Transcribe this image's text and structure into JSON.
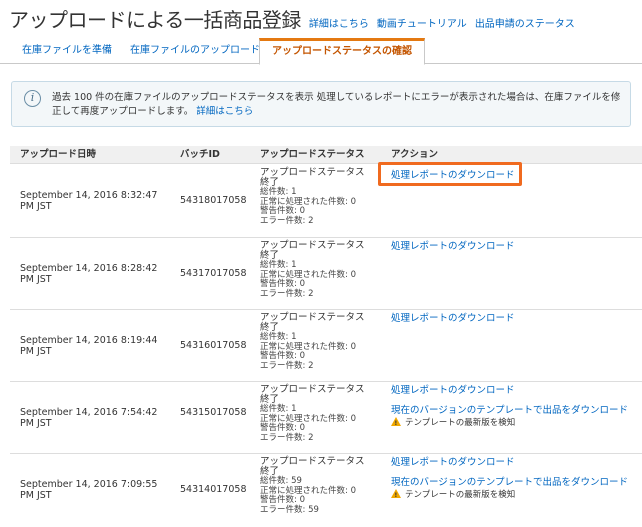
{
  "header": {
    "title": "アップロードによる一括商品登録",
    "links": [
      "詳細はこちら",
      "動画チュートリアル",
      "出品申請のステータス"
    ]
  },
  "tabs": [
    {
      "label": "在庫ファイルを準備"
    },
    {
      "label": "在庫ファイルのアップロード"
    },
    {
      "label": "アップロードステータスの確認",
      "active": true
    }
  ],
  "info": {
    "text": "過去 100 件の在庫ファイルのアップロードステータスを表示 処理しているレポートにエラーが表示された場合は、在庫ファイルを修正して再度アップロードします。",
    "link": "詳細はこちら"
  },
  "table": {
    "headers": [
      "アップロード日時",
      "バッチID",
      "アップロードステータス",
      "アクション"
    ],
    "rows": [
      {
        "date": "September 14, 2016 8:32:47 PM JST",
        "batch": "54318017058",
        "status": "アップロードステータス",
        "state": "終了",
        "total": "総件数: 1",
        "ok": "正常に処理された件数: 0",
        "warnings": "警告件数: 0",
        "errors": "エラー件数: 2",
        "action": "処理レポートのダウンロード"
      },
      {
        "date": "September 14, 2016 8:28:42 PM JST",
        "batch": "54317017058",
        "status": "アップロードステータス",
        "state": "終了",
        "total": "総件数: 1",
        "ok": "正常に処理された件数: 0",
        "warnings": "警告件数: 0",
        "errors": "エラー件数: 2",
        "action": "処理レポートのダウンロード"
      },
      {
        "date": "September 14, 2016 8:19:44 PM JST",
        "batch": "54316017058",
        "status": "アップロードステータス",
        "state": "終了",
        "total": "総件数: 1",
        "ok": "正常に処理された件数: 0",
        "warnings": "警告件数: 0",
        "errors": "エラー件数: 2",
        "action": "処理レポートのダウンロード"
      },
      {
        "date": "September 14, 2016 7:54:42 PM JST",
        "batch": "54315017058",
        "status": "アップロードステータス",
        "state": "終了",
        "total": "総件数: 1",
        "ok": "正常に処理された件数: 0",
        "warnings": "警告件数: 0",
        "errors": "エラー件数: 2",
        "action": "処理レポートのダウンロード",
        "action2": "現在のバージョンのテンプレートで出品をダウンロード",
        "warn": "テンプレートの最新版を検知"
      },
      {
        "date": "September 14, 2016 7:09:55 PM JST",
        "batch": "54314017058",
        "status": "アップロードステータス",
        "state": "終了",
        "total": "総件数: 59",
        "ok": "正常に処理された件数: 0",
        "warnings": "警告件数: 0",
        "errors": "エラー件数: 59",
        "action": "処理レポートのダウンロード",
        "action2": "現在のバージョンのテンプレートで出品をダウンロード",
        "warn": "テンプレートの最新版を検知"
      }
    ]
  }
}
